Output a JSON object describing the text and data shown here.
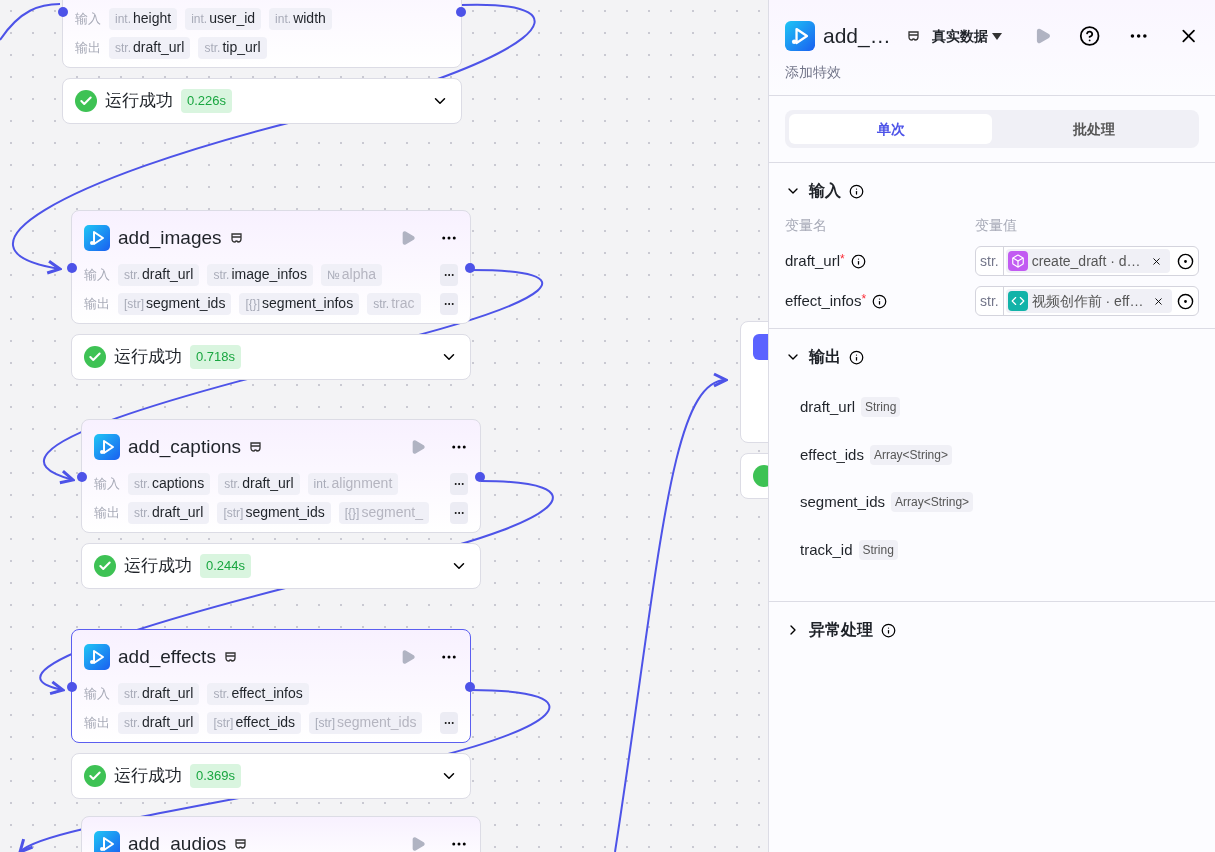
{
  "canvas": {
    "nodes": [
      {
        "kind": "node",
        "selected": false,
        "rows": [
          {
            "label": "输入",
            "more": false,
            "chips": [
              {
                "type": "int.",
                "name": "height",
                "faded": false
              },
              {
                "type": "int.",
                "name": "user_id",
                "faded": false
              },
              {
                "type": "int.",
                "name": "width",
                "faded": false
              }
            ]
          },
          {
            "label": "输出",
            "more": false,
            "chips": [
              {
                "type": "str.",
                "name": "draft_url",
                "faded": false
              },
              {
                "type": "str.",
                "name": "tip_url",
                "faded": false
              }
            ]
          }
        ],
        "status": {
          "text": "运行成功",
          "time": "0.226s",
          "success": true
        }
      },
      {
        "kind": "node",
        "title": "add_images",
        "selected": false,
        "rows": [
          {
            "label": "输入",
            "more": true,
            "chips": [
              {
                "type": "str.",
                "name": "draft_url",
                "faded": false
              },
              {
                "type": "str.",
                "name": "image_infos",
                "faded": false
              },
              {
                "type": "№",
                "name": "alpha",
                "faded": true
              }
            ]
          },
          {
            "label": "输出",
            "more": true,
            "chips": [
              {
                "type": "[str]",
                "name": "segment_ids",
                "faded": false
              },
              {
                "type": "[{}]",
                "name": "segment_infos",
                "faded": false
              },
              {
                "type": "str.",
                "name": "trac",
                "faded": true
              }
            ]
          }
        ],
        "status": {
          "text": "运行成功",
          "time": "0.718s",
          "success": true
        }
      },
      {
        "kind": "node",
        "title": "add_captions",
        "selected": false,
        "rows": [
          {
            "label": "输入",
            "more": true,
            "chips": [
              {
                "type": "str.",
                "name": "captions",
                "faded": false
              },
              {
                "type": "str.",
                "name": "draft_url",
                "faded": false
              },
              {
                "type": "int.",
                "name": "alignment",
                "faded": true
              }
            ]
          },
          {
            "label": "输出",
            "more": true,
            "chips": [
              {
                "type": "str.",
                "name": "draft_url",
                "faded": false
              },
              {
                "type": "[str]",
                "name": "segment_ids",
                "faded": false
              },
              {
                "type": "[{}]",
                "name": "segment_",
                "faded": true
              }
            ]
          }
        ],
        "status": {
          "text": "运行成功",
          "time": "0.244s",
          "success": true
        }
      },
      {
        "kind": "node",
        "title": "add_effects",
        "selected": true,
        "rows": [
          {
            "label": "输入",
            "more": false,
            "chips": [
              {
                "type": "str.",
                "name": "draft_url",
                "faded": false
              },
              {
                "type": "str.",
                "name": "effect_infos",
                "faded": false
              }
            ]
          },
          {
            "label": "输出",
            "more": true,
            "chips": [
              {
                "type": "str.",
                "name": "draft_url",
                "faded": false
              },
              {
                "type": "[str]",
                "name": "effect_ids",
                "faded": false
              },
              {
                "type": "[str]",
                "name": "segment_ids",
                "faded": true
              }
            ]
          }
        ],
        "status": {
          "text": "运行成功",
          "time": "0.369s",
          "success": true
        }
      },
      {
        "kind": "node",
        "title": "add_audios",
        "selected": false
      },
      {
        "kind": "hidden",
        "success": true
      }
    ]
  },
  "panel": {
    "title": "add_…",
    "data_source": "真实数据",
    "description": "添加特效",
    "tabs": [
      {
        "label": "单次",
        "selected": true
      },
      {
        "label": "批处理",
        "selected": false
      }
    ],
    "input": {
      "title": "输入",
      "expanded": true,
      "columns": [
        "变量名",
        "变量值"
      ],
      "params": [
        {
          "name": "draft_url",
          "required_mark": "*",
          "type": "str.",
          "source": "create_draft · d…",
          "kind": "plugin"
        },
        {
          "name": "effect_infos",
          "required_mark": "*",
          "type": "str.",
          "source": "视频创作前 · eff…",
          "kind": "code"
        }
      ]
    },
    "output": {
      "title": "输出",
      "expanded": true,
      "fields": [
        {
          "name": "draft_url",
          "type": "String"
        },
        {
          "name": "effect_ids",
          "type": "Array<String>"
        },
        {
          "name": "segment_ids",
          "type": "Array<String>"
        },
        {
          "name": "track_id",
          "type": "String"
        }
      ]
    },
    "error_handling": {
      "title": "异常处理",
      "expanded": false
    }
  }
}
